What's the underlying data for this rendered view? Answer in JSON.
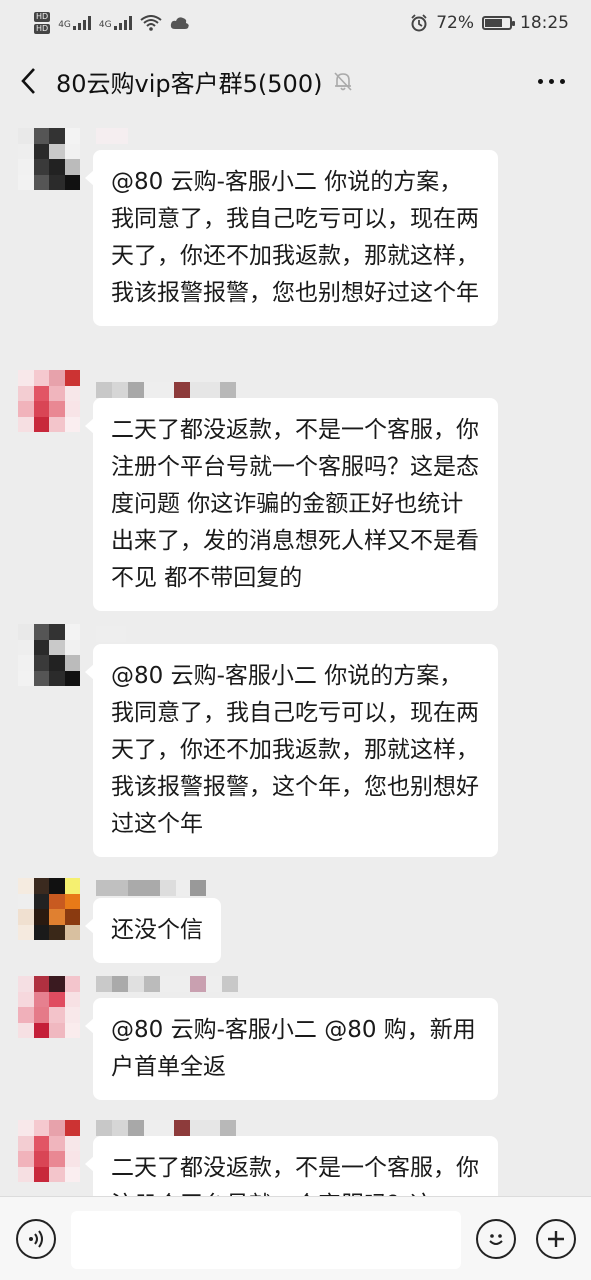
{
  "status_bar": {
    "network": "4G",
    "network2": "4G",
    "battery_text": "72%",
    "battery_level": 0.72,
    "time": "18:25"
  },
  "header": {
    "title": "80云购vip客户群5(500)"
  },
  "messages": [
    {
      "text": "@80 云购-客服小二  你说的方案，我同意了，我自己吃亏可以，现在两天了，你还不加我返款，那就这样，我该报警报警，您也别想好过这个年"
    },
    {
      "text": "二天了都没返款，不是一个客服，你注册个平台号就一个客服吗？这是态度问题  你这诈骗的金额正好也统计出来了，发的消息想死人样又不是看不见 都不带回复的"
    },
    {
      "text": "@80 云购-客服小二  你说的方案，我同意了，我自己吃亏可以，现在两天了，你还不加我返款，那就这样，我该报警报警，这个年，您也别想好过这个年"
    },
    {
      "text": "还没个信"
    },
    {
      "text": "@80 云购-客服小二  @80 购，新用户首单全返"
    },
    {
      "text": "二天了都没返款，不是一个客服，你注册个平台号就一个客服吗？这"
    }
  ],
  "input": {
    "value": ""
  },
  "icons": {
    "back": "chevron-left-icon",
    "mute": "bell-off-icon",
    "more": "more-dots-icon",
    "voice": "voice-icon",
    "emoji": "emoji-icon",
    "plus": "plus-icon"
  }
}
